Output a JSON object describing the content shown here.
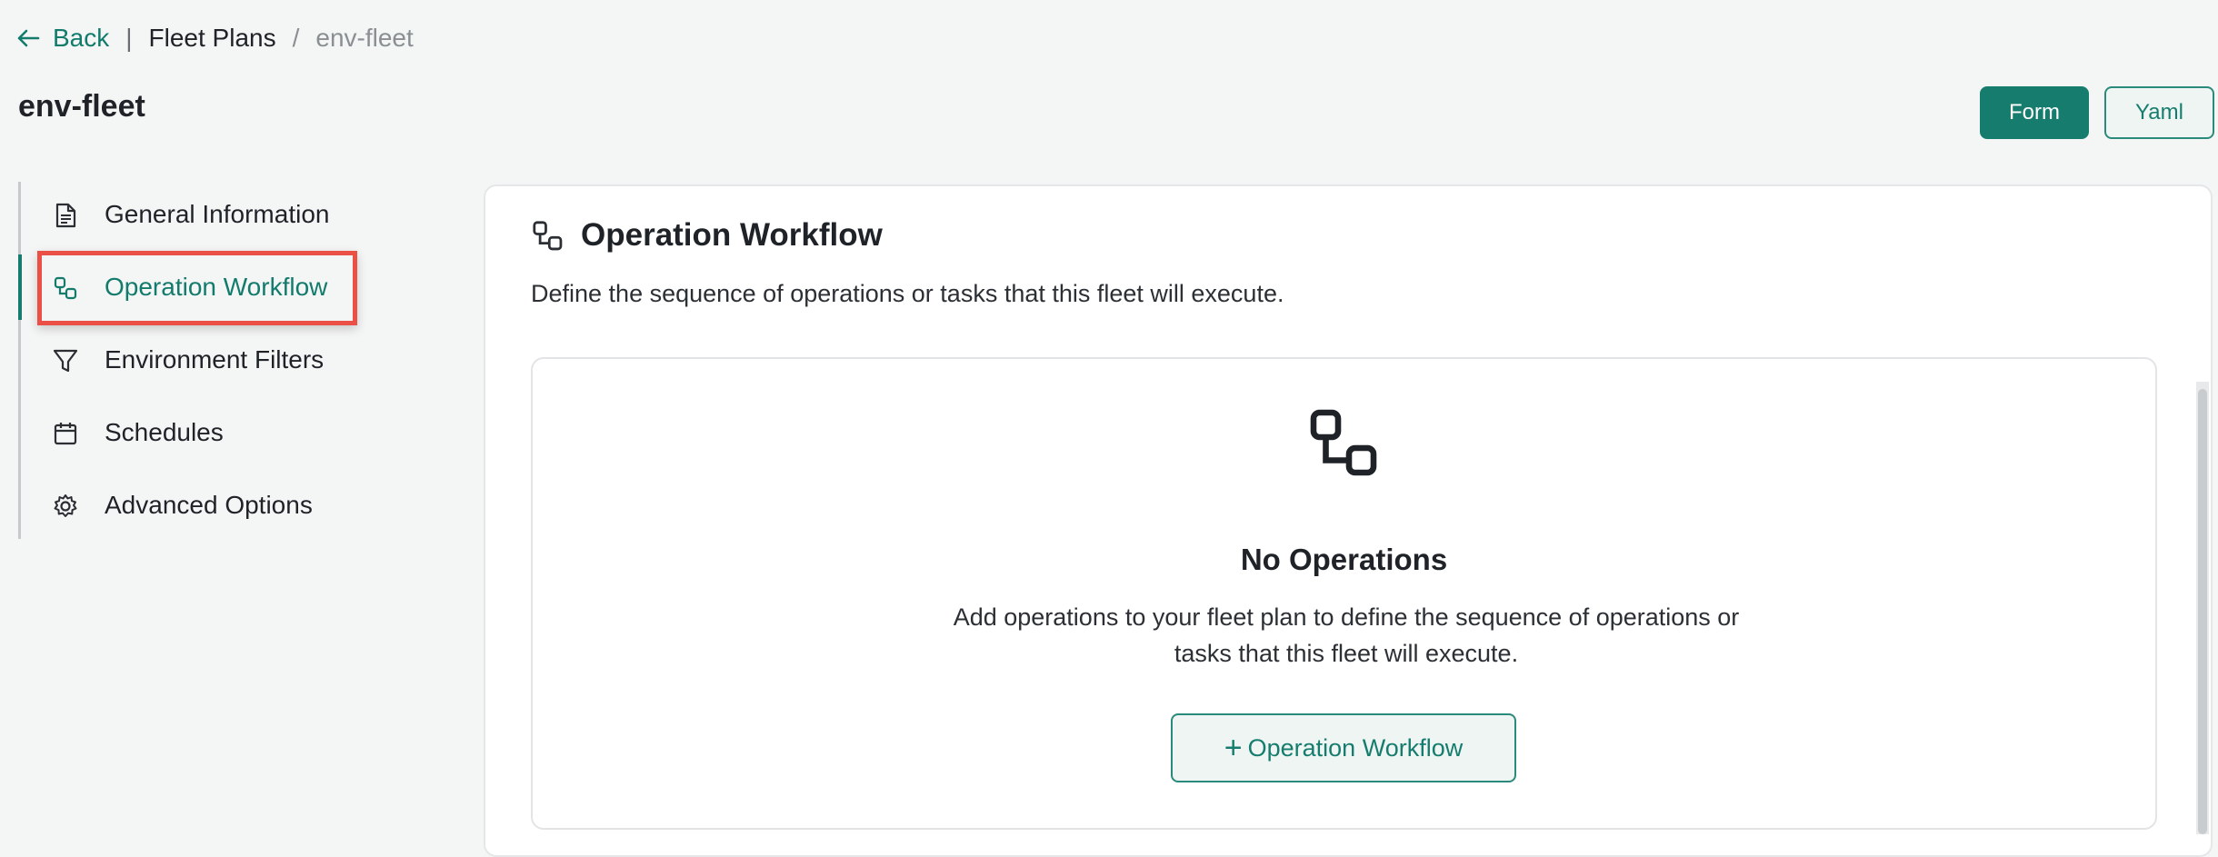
{
  "breadcrumb": {
    "back_label": "Back",
    "separator": "|",
    "parent": "Fleet Plans",
    "slash": "/",
    "current": "env-fleet"
  },
  "page": {
    "title": "env-fleet"
  },
  "modes": {
    "form_label": "Form",
    "yaml_label": "Yaml"
  },
  "sidebar": {
    "items": [
      {
        "label": "General Information",
        "icon": "document-icon"
      },
      {
        "label": "Operation Workflow",
        "icon": "workflow-icon",
        "active": true
      },
      {
        "label": "Environment Filters",
        "icon": "filter-icon"
      },
      {
        "label": "Schedules",
        "icon": "calendar-icon"
      },
      {
        "label": "Advanced Options",
        "icon": "gear-icon"
      }
    ]
  },
  "panel": {
    "title": "Operation Workflow",
    "description": "Define the sequence of operations or tasks that this fleet will execute.",
    "empty_state": {
      "title": "No Operations",
      "description": "Add operations to your fleet plan to define the sequence of operations or tasks that this fleet will execute.",
      "button_plus": "+",
      "button_label": "Operation Workflow"
    }
  },
  "colors": {
    "accent": "#167d6e",
    "highlight": "#ea5045",
    "background": "#f4f5f5"
  }
}
